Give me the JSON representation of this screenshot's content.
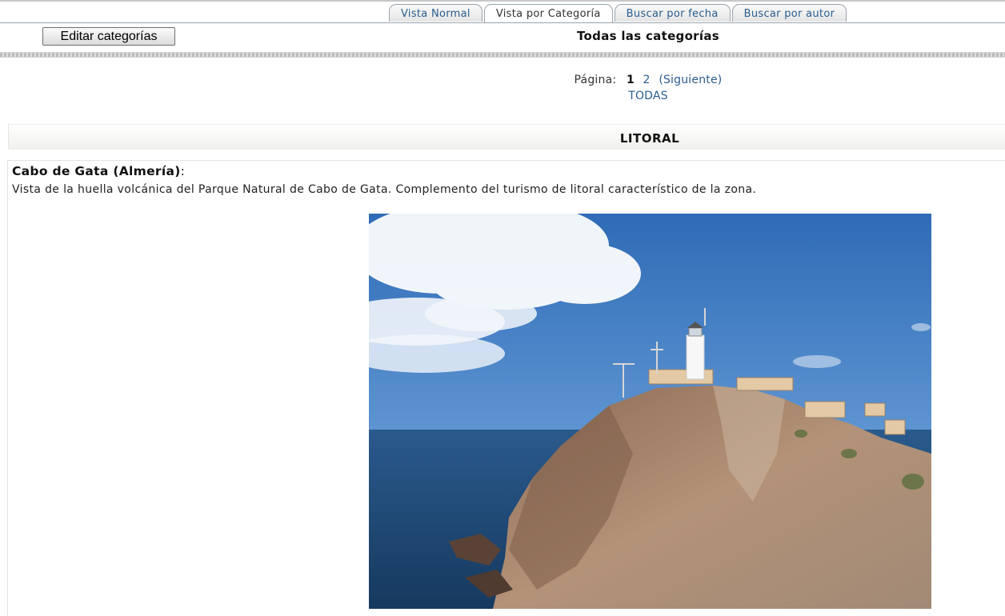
{
  "tabs": [
    {
      "label": "Vista Normal",
      "active": false
    },
    {
      "label": "Vista por Categoría",
      "active": true
    },
    {
      "label": "Buscar por fecha",
      "active": false
    },
    {
      "label": "Buscar por autor",
      "active": false
    }
  ],
  "toolbar": {
    "edit_label": "Editar categorías"
  },
  "page_title": "Todas las categorías",
  "pagination": {
    "label": "Página:",
    "current": "1",
    "page2": "2",
    "next": "(Siguiente)",
    "all": "TODAS"
  },
  "category": {
    "title": "LITORAL"
  },
  "entry": {
    "title": "Cabo de Gata (Almería)",
    "title_suffix": ":",
    "description": "Vista de la huella volcánica del Parque Natural de Cabo de Gata. Complemento del turismo de litoral característico de la zona."
  },
  "colors": {
    "link": "#2a5d8f",
    "sky": "#3d78bf",
    "sea": "#1f4a78",
    "rock": "#a0826a"
  }
}
